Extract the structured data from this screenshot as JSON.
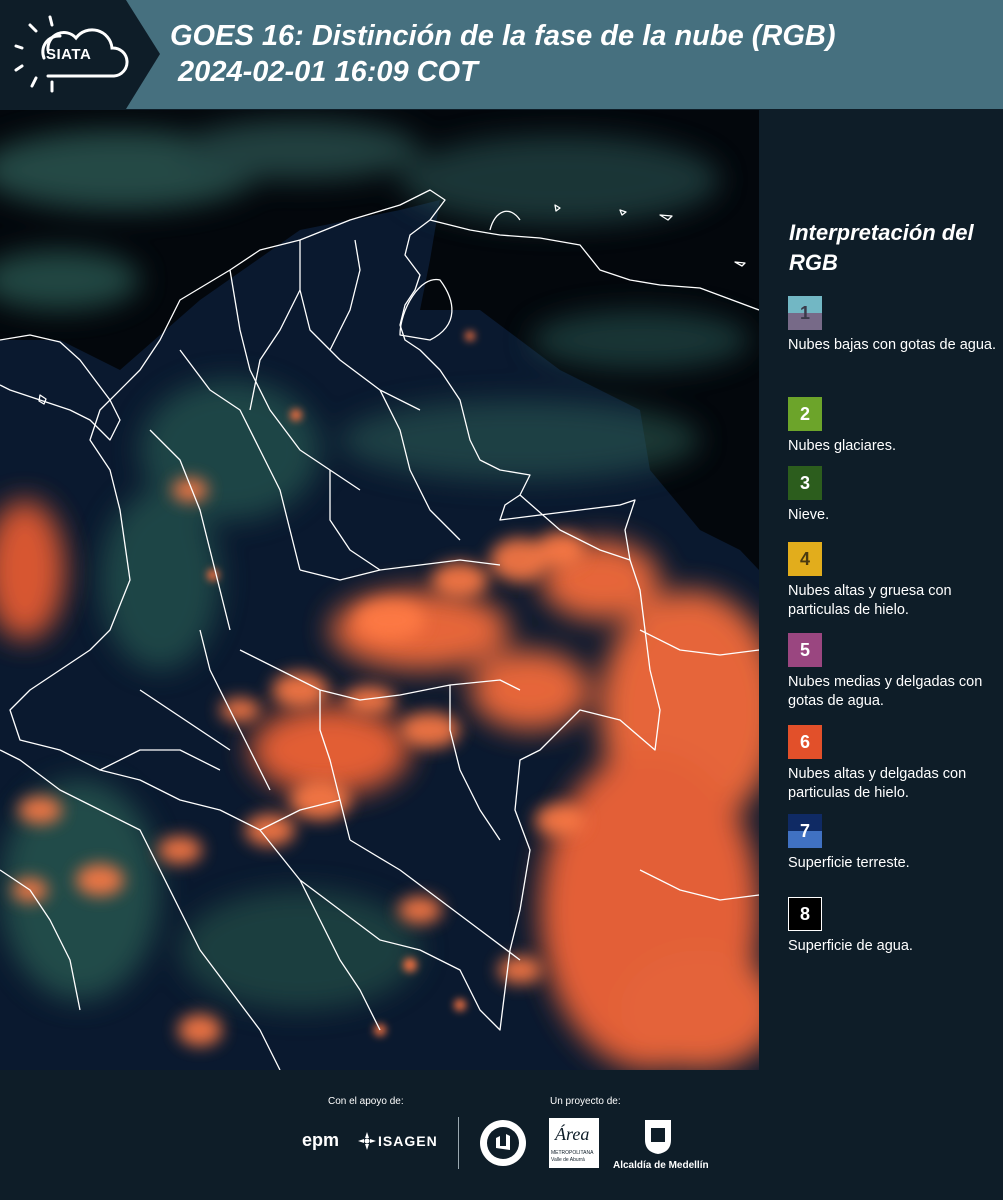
{
  "header": {
    "logo_text": "SIATA",
    "title_line1": "GOES 16: Distinción de la fase de la nube (RGB)",
    "title_line2": " 2024-02-01 16:09 COT"
  },
  "legend": {
    "title": "Interpretación del RGB",
    "items": [
      {
        "number": "1",
        "label": "Nubes bajas con gotas de agua.",
        "color_top": "#72b7c4",
        "color_bottom": "#776a88",
        "text_color": "#3a3a4a"
      },
      {
        "number": "2",
        "label": "Nubes glaciares.",
        "color_top": "#6ca42a",
        "color_bottom": "#6ca42a",
        "text_color": "#ffffff"
      },
      {
        "number": "3",
        "label": "Nieve.",
        "color_top": "#2c5d1d",
        "color_bottom": "#2c5d1d",
        "text_color": "#ffffff"
      },
      {
        "number": "4",
        "label": "Nubes altas y gruesa con particulas de hielo.",
        "color_top": "#e2ad1c",
        "color_bottom": "#e2ad1c",
        "text_color": "#4a3a10"
      },
      {
        "number": "5",
        "label": "Nubes medias y delgadas con gotas de agua.",
        "color_top": "#9a4680",
        "color_bottom": "#9a4680",
        "text_color": "#ffffff"
      },
      {
        "number": "6",
        "label": "Nubes altas y delgadas con particulas de hielo.",
        "color_top": "#e2502a",
        "color_bottom": "#e2502a",
        "text_color": "#ffffff"
      },
      {
        "number": "7",
        "label": "Superficie terreste.",
        "color_top": "#0f2a64",
        "color_bottom": "#4071c2",
        "text_color": "#ffffff"
      },
      {
        "number": "8",
        "label": "Superficie de agua.",
        "color_top": "#000000",
        "color_bottom": "#000000",
        "text_color": "#ffffff"
      }
    ]
  },
  "footer": {
    "support_label": "Con el apoyo de:",
    "project_label": "Un proyecto de:",
    "sponsors": [
      "epm",
      "ISAGEN"
    ],
    "partners": [
      "Área Metropolitana Valle de Aburrá",
      "Alcaldía de Medellín"
    ],
    "epm_text": "epm",
    "isagen_text": "ISAGEN",
    "area_text": "Área",
    "area_sub1": "METROPOLITANA",
    "area_sub2": "Valle de Aburrá",
    "alcaldia_text": "Alcaldía de Medellín"
  },
  "colors": {
    "background": "#0e1d28",
    "header": "#46707f",
    "cloud_ice": "#f26a3a",
    "cloud_low": "#3e8a7c",
    "border_lines": "#ffffff"
  }
}
